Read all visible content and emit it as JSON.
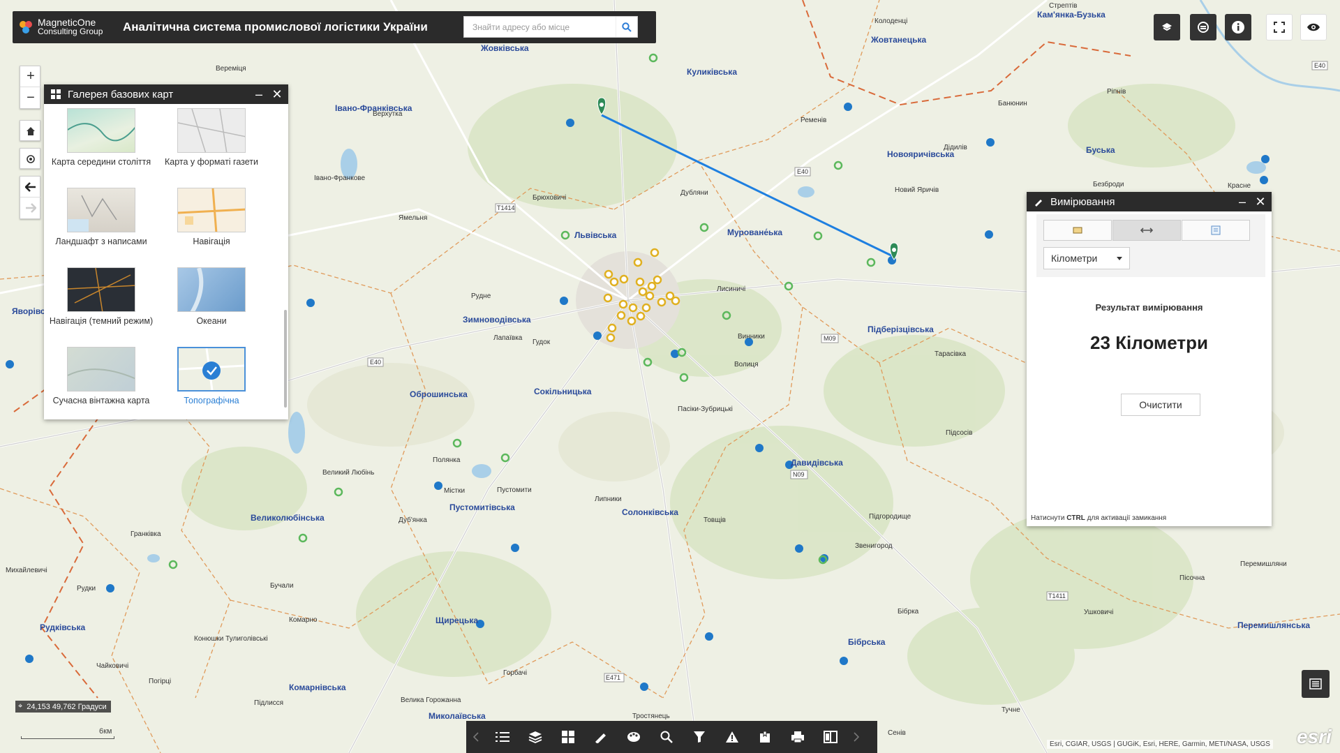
{
  "header": {
    "logo_line1": "MagneticOne",
    "logo_line2": "Consulting Group",
    "title": "Аналітична система промислової логістики України",
    "search_placeholder": "Знайти адресу або місце"
  },
  "gallery": {
    "title": "Галерея базових карт",
    "items": [
      {
        "label": "Карта середини століття",
        "selected": false
      },
      {
        "label": "Карта у форматі газети",
        "selected": false
      },
      {
        "label": "Ландшафт з написами",
        "selected": false
      },
      {
        "label": "Навігація",
        "selected": false
      },
      {
        "label": "Навігація (темний режим)",
        "selected": false
      },
      {
        "label": "Океани",
        "selected": false
      },
      {
        "label": "Сучасна вінтажна карта",
        "selected": false
      },
      {
        "label": "Топографічна",
        "selected": true
      }
    ]
  },
  "measurement": {
    "title": "Вимірювання",
    "unit": "Кілометри",
    "result_label": "Результат вимірювання",
    "result_value": "23 Кілометри",
    "clear_label": "Очистити",
    "hint_prefix": "Натиснути ",
    "hint_key": "CTRL",
    "hint_suffix": " для активації замикання"
  },
  "status": {
    "coordinates": "24,153 49,762 Градуси",
    "scale_label": "6км",
    "attribution": "Esri, CGIAR, USGS | GUGiK, Esri, HERE, Garmin, METI/NASA, USGS",
    "esri_logo": "esri"
  },
  "map_labels": {
    "regions": [
      "Жовківська",
      "Куликівська",
      "Жовтанецька",
      "Кам'янка-Бузька",
      "Івано-Франківська",
      "Новояричівська",
      "Буська",
      "Львівська",
      "Муроване́ька",
      "Пустомитівська",
      "Зимноводівська",
      "Підберізцівська",
      "Оброшинська",
      "Сокільницька",
      "Давидівська",
      "Солонківська",
      "Великолюбінська",
      "Щирецька",
      "Комарнівська",
      "Бібрська",
      "Рудківська",
      "Миколаївська",
      "Перемишлянська",
      "Яворівська"
    ],
    "places": [
      "Колоденці",
      "Стрептів",
      "Ременів",
      "Банюнин",
      "Ріпнів",
      "Дідилів",
      "Новий Яричів",
      "Безброди",
      "Красне",
      "Брюховичі",
      "Дубляни",
      "Ямельня",
      "Рудне",
      "Лапаївка",
      "Гудок",
      "Лисиничі",
      "Винники",
      "Волиця",
      "Тарасівка",
      "Пасіки-Зубрицькі",
      "Підсосів",
      "Великий Любінь",
      "Полянка",
      "Містки",
      "Пустомити",
      "Липники",
      "Товщів",
      "Підгородище",
      "Звенигород",
      "Гранківка",
      "Дуб'янка",
      "Бучали",
      "Комарно",
      "Конюшки Тулиголівські",
      "Рудки",
      "Михайлевичі",
      "Чайковичі",
      "Погірці",
      "Підлисся",
      "Велика Горожанна",
      "Горбачі",
      "Тростянець",
      "Бібрка",
      "Ушковичі",
      "Перемишляни",
      "Пісочна",
      "Тучне",
      "Сенів",
      "Вереміця",
      "Верхутка",
      "Івано-Франкове"
    ],
    "roads": [
      "E40",
      "T1414",
      "E40",
      "M09",
      "N09",
      "E471",
      "T1411",
      "E40"
    ]
  },
  "colors": {
    "panel_header": "#2b2b2b",
    "measure_line": "#1e7fe0",
    "pin_green": "#2e8b57",
    "poi_blue": "#1f78c8",
    "poi_green": "#5cb85c",
    "poi_yellow": "#e0b020",
    "admin_border": "#d97b3a",
    "selected_accent": "#2a7fd4"
  },
  "icons": {
    "search": "search-icon",
    "zoom_in": "plus-icon",
    "zoom_out": "minus-icon",
    "home": "home-icon",
    "locate": "locate-icon",
    "back": "arrow-left-icon",
    "forward": "arrow-right-icon"
  }
}
